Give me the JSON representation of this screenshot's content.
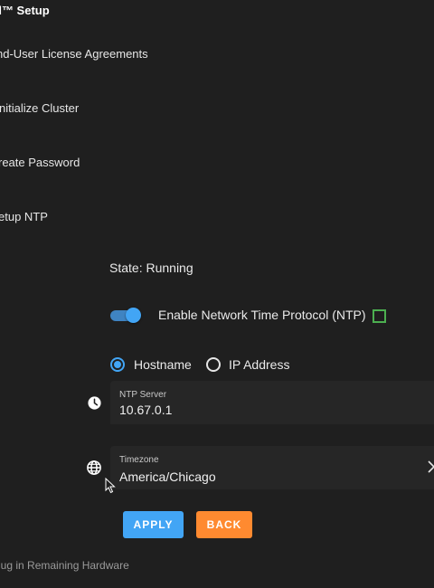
{
  "app": {
    "title": "d™ Setup"
  },
  "steps": [
    {
      "label": "nd-User License Agreements"
    },
    {
      "label": "nitialize Cluster"
    },
    {
      "label": "reate Password"
    },
    {
      "label": "etup NTP"
    }
  ],
  "ntp": {
    "state_text": "State: Running",
    "enable_label": "Enable Network Time Protocol (NTP)",
    "enabled": true,
    "radio_hostname": "Hostname",
    "radio_ip": "IP Address",
    "selected_mode": "Hostname",
    "server_label": "NTP Server",
    "server_value": "10.67.0.1",
    "timezone_label": "Timezone",
    "timezone_value": "America/Chicago"
  },
  "buttons": {
    "apply": "APPLY",
    "back": "BACK"
  },
  "footer_step": "lug in Remaining Hardware",
  "colors": {
    "accent": "#42a5f5",
    "back": "#ff8a30",
    "checkbox": "#4caf50",
    "background": "#1f1f1f"
  }
}
